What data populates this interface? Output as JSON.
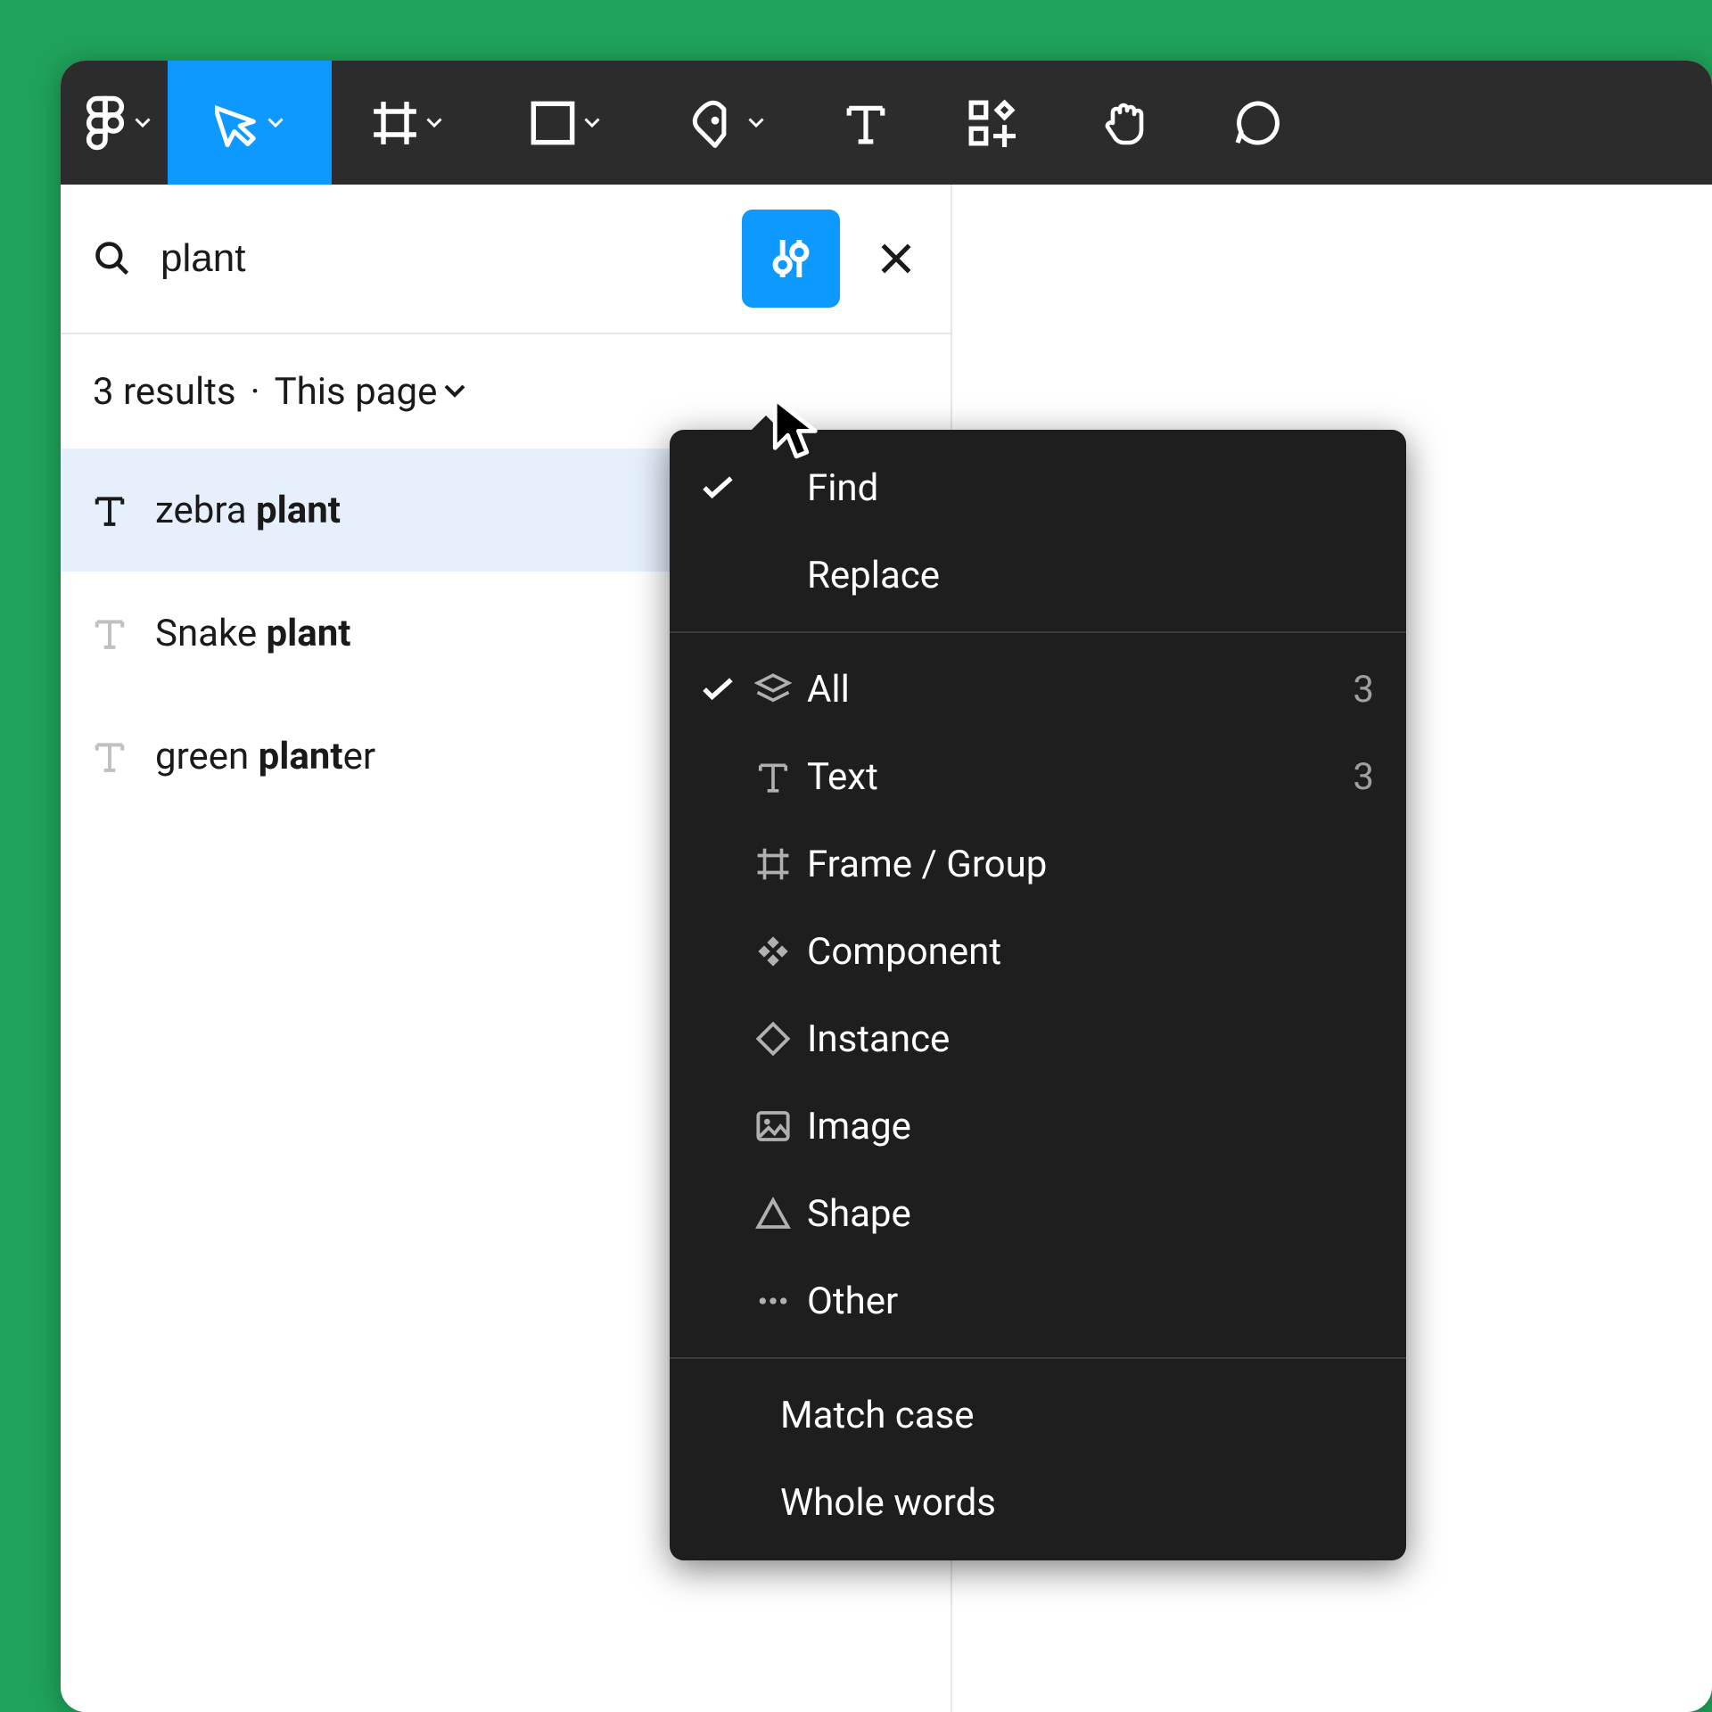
{
  "search": {
    "value": "plant"
  },
  "results": {
    "count": "3 results",
    "scope": "This page",
    "items": [
      {
        "pre": "zebra ",
        "match": "plant",
        "post": "",
        "selected": true
      },
      {
        "pre": "Snake ",
        "match": "plant",
        "post": "",
        "selected": false
      },
      {
        "pre": "green ",
        "match": "plant",
        "post": "er",
        "selected": false
      }
    ]
  },
  "dropdown": {
    "modes": [
      {
        "label": "Find",
        "checked": true
      },
      {
        "label": "Replace",
        "checked": false
      }
    ],
    "filters": [
      {
        "label": "All",
        "count": "3",
        "checked": true,
        "icon": "layers"
      },
      {
        "label": "Text",
        "count": "3",
        "checked": false,
        "icon": "text"
      },
      {
        "label": "Frame / Group",
        "count": "",
        "checked": false,
        "icon": "frame"
      },
      {
        "label": "Component",
        "count": "",
        "checked": false,
        "icon": "component"
      },
      {
        "label": "Instance",
        "count": "",
        "checked": false,
        "icon": "instance"
      },
      {
        "label": "Image",
        "count": "",
        "checked": false,
        "icon": "image"
      },
      {
        "label": "Shape",
        "count": "",
        "checked": false,
        "icon": "shape"
      },
      {
        "label": "Other",
        "count": "",
        "checked": false,
        "icon": "dots"
      }
    ],
    "options": [
      {
        "label": "Match case"
      },
      {
        "label": "Whole words"
      }
    ]
  }
}
